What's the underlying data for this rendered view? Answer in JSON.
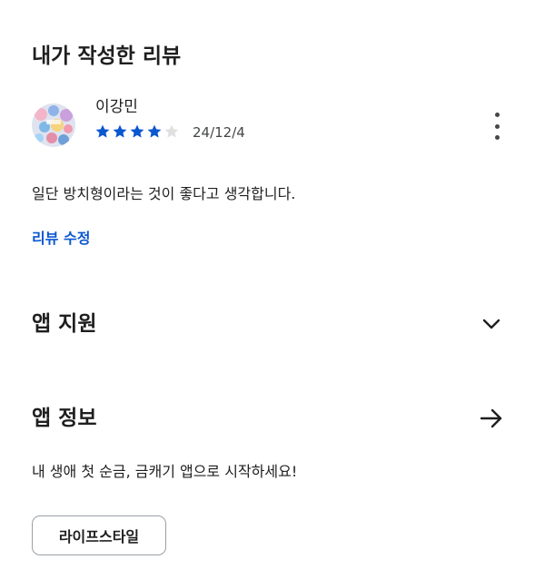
{
  "review_section": {
    "title": "내가 작성한 리뷰",
    "reviewer_name": "이강민",
    "rating": 4,
    "max_rating": 5,
    "date": "24/12/4",
    "review_text": "일단 방치형이라는 것이 좋다고 생각합니다.",
    "edit_label": "리뷰 수정",
    "star_color_filled": "#0b57d0",
    "star_color_empty": "#e0e0e0"
  },
  "app_support": {
    "title": "앱 지원",
    "icon": "chevron-down-icon"
  },
  "app_info": {
    "title": "앱 정보",
    "icon": "arrow-right-icon",
    "description": "내 생애 첫 순금, 금캐기 앱으로 시작하세요!",
    "category": "라이프스타일"
  },
  "colors": {
    "link": "#0b57d0",
    "text": "#1f1f1f",
    "secondary_text": "#444746"
  }
}
